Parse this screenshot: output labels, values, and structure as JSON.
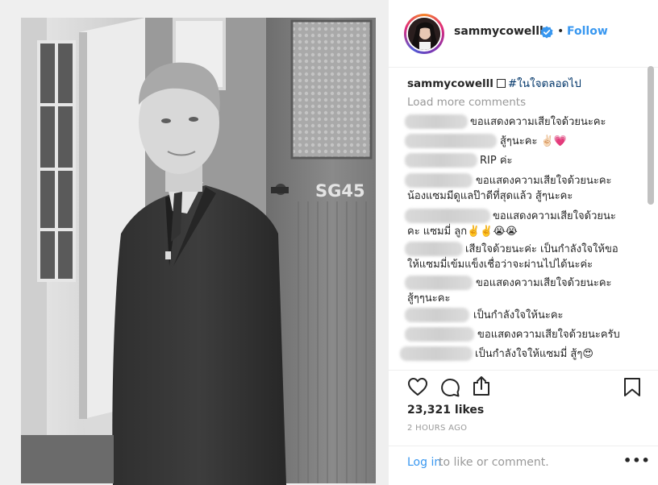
{
  "post": {
    "username": "sammycowelll",
    "follow_label": "Follow",
    "dot": "•",
    "caption_username": "sammycowelll",
    "caption_hashtag": "#ในใจตลอดไป",
    "load_more": "Load more comments",
    "likes": "23,321 likes",
    "time": "2 HOURS AGO",
    "login_link": "Log in",
    "login_rest": " to like or comment.",
    "more": "•••",
    "accent_color": "#3897f0"
  },
  "comments": [
    {
      "text": "ขอแสดงความเสียใจด้วยนะคะ"
    },
    {
      "text": "สู้ๆนะคะ ✌🏻💗"
    },
    {
      "text": "RIP ค่ะ"
    },
    {
      "text": "ขอแสดงความเสียใจด้วยนะคะ",
      "text2": "น้องแซมมีดูแลป๊าดีที่สุดแล้ว สู้ๆนะคะ"
    },
    {
      "text": "ขอแสดงความเสียใจด้วยนะ",
      "text2": "คะ แซมมี่ ลูก✌️✌️😭😭"
    },
    {
      "text": "เสียใจด้วยนะค่ะ เป็นกำลังใจให้ขอ",
      "text2": "ให้แซมมี่เข้มแข็งเชื่อว่าจะผ่านไปได้นะค่ะ"
    },
    {
      "text": "ขอแสดงความเสียใจด้วยนะคะ",
      "text2": "สู้ๆๆนะคะ"
    },
    {
      "text": "เป็นกำลังใจให้นะคะ"
    },
    {
      "text": "ขอแสดงความเสียใจด้วยนะครับ"
    },
    {
      "text": "เป็นกำลังใจให้แซมมี่ สู้ๆ😍"
    }
  ],
  "photo": {
    "door_number": "SG45"
  },
  "icons": [
    "verified-badge-icon",
    "heart-icon",
    "comment-icon",
    "share-icon",
    "bookmark-icon",
    "more-options-icon"
  ]
}
